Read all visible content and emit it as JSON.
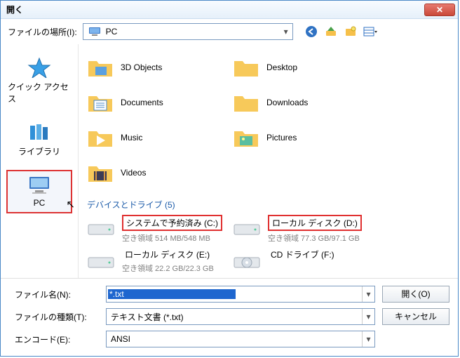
{
  "window": {
    "title": "開く"
  },
  "toolbar": {
    "location_label": "ファイルの場所(I):",
    "location_value": "PC"
  },
  "sidebar": {
    "items": [
      {
        "label": "クイック アクセス"
      },
      {
        "label": "ライブラリ"
      },
      {
        "label": "PC"
      }
    ]
  },
  "main": {
    "folders": [
      {
        "label": "3D Objects"
      },
      {
        "label": "Desktop"
      },
      {
        "label": "Documents"
      },
      {
        "label": "Downloads"
      },
      {
        "label": "Music"
      },
      {
        "label": "Pictures"
      },
      {
        "label": "Videos"
      }
    ],
    "devices_header": "デバイスとドライブ (5)",
    "drives": [
      {
        "name": "システムで予約済み (C:)",
        "sub": "空き領域 514 MB/548 MB",
        "highlight": true
      },
      {
        "name": "ローカル ディスク (D:)",
        "sub": "空き領域 77.3 GB/97.1 GB",
        "highlight": true
      },
      {
        "name": "ローカル ディスク (E:)",
        "sub": "空き領域 22.2 GB/22.3 GB",
        "highlight": false
      },
      {
        "name": "CD ドライブ (F:)",
        "sub": "",
        "highlight": false
      }
    ]
  },
  "bottom": {
    "filename_label": "ファイル名(N):",
    "filename_value": "*.txt",
    "filetype_label": "ファイルの種類(T):",
    "filetype_value": "テキスト文書 (*.txt)",
    "encoding_label": "エンコード(E):",
    "encoding_value": "ANSI",
    "open_btn": "開く(O)",
    "cancel_btn": "キャンセル"
  }
}
